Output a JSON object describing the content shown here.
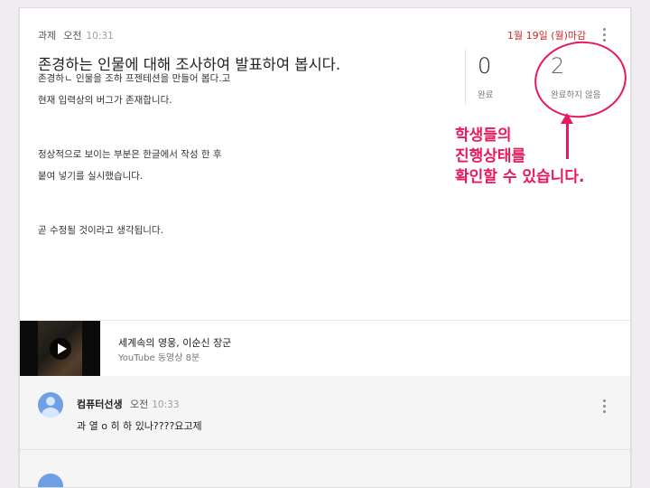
{
  "post": {
    "type_label": "과제",
    "time_period": "오전",
    "time": "10:31",
    "due": "1월 19일 (월)마감",
    "title": "존경하는 인물에 대해 조사하여 발표하여 봅시다.",
    "description_lines": [
      "존경하ㄴ 인물을 조하 프젠테션을 만들어 봅다.고",
      "",
      "현재 입력상의 버그가 존재합니다.",
      "",
      "",
      "",
      "",
      "정상적으로 보이는 부분은 한글에서 작성 한 후",
      "",
      "붙여 넣기를 실시했습니다.",
      "",
      "",
      "",
      "",
      "곧 수정될 것이라고 생각됩니다."
    ]
  },
  "stats": {
    "done_count": "0",
    "done_label": "완료",
    "not_done_count": "2",
    "not_done_label": "완료하지 않음"
  },
  "annotation": {
    "lines": [
      "학생들의",
      "진행상태를",
      "확인할 수 있습니다."
    ],
    "color": "#e8195a"
  },
  "attachment": {
    "title": "세계속의 영웅, 이순신 장군",
    "subtitle": "YouTube 동영상  8분",
    "icon": "play-icon"
  },
  "comments": [
    {
      "author": "컴퓨터선생",
      "time_period": "오전",
      "time": "10:33",
      "text": "과 열 o 히 하 있나????요고제"
    }
  ],
  "colors": {
    "background": "#f1ecf2",
    "due_red": "#c62828",
    "avatar_blue": "#6ea0e6"
  }
}
